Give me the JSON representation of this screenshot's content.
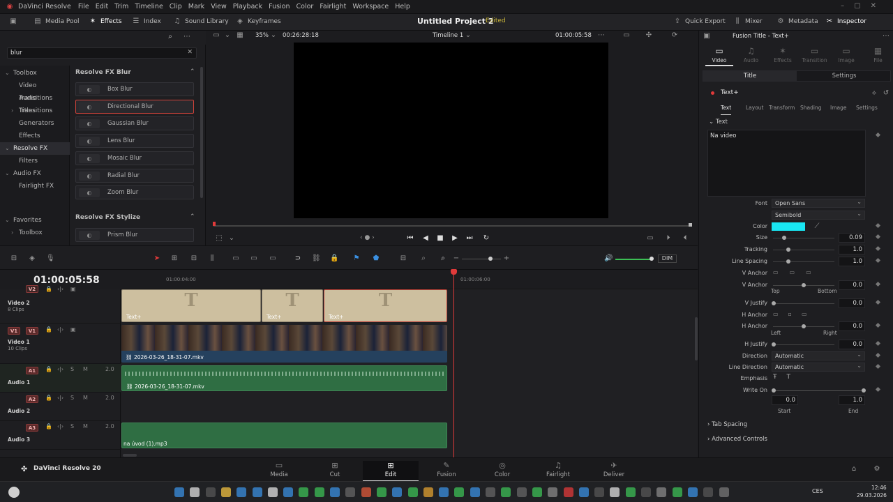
{
  "menu": {
    "app_name": "DaVinci Resolve",
    "items": [
      "File",
      "Edit",
      "Trim",
      "Timeline",
      "Clip",
      "Mark",
      "View",
      "Playback",
      "Fusion",
      "Color",
      "Fairlight",
      "Workspace",
      "Help"
    ]
  },
  "toolbar": {
    "media_pool": "Media Pool",
    "effects": "Effects",
    "index": "Index",
    "sound_library": "Sound Library",
    "keyframes": "Keyframes",
    "project_title": "Untitled Project 2",
    "project_status": "Edited",
    "quick_export": "Quick Export",
    "mixer": "Mixer",
    "metadata": "Metadata",
    "inspector": "Inspector"
  },
  "effects_panel": {
    "search_value": "blur",
    "tree": [
      {
        "label": "Toolbox",
        "level": 0,
        "caret": true
      },
      {
        "label": "Video Transitions",
        "level": 1
      },
      {
        "label": "Audio Transitions",
        "level": 1
      },
      {
        "label": "Titles",
        "level": 1,
        "caret": true
      },
      {
        "label": "Generators",
        "level": 1
      },
      {
        "label": "Effects",
        "level": 1
      },
      {
        "label": "Resolve FX",
        "level": 0,
        "caret": true,
        "selected": true
      },
      {
        "label": "Filters",
        "level": 1
      },
      {
        "label": "Audio FX",
        "level": 0,
        "caret": true
      },
      {
        "label": "Fairlight FX",
        "level": 1
      }
    ],
    "favorites": "Favorites",
    "favorites_toolbox": "Toolbox",
    "group1": "Resolve FX Blur",
    "items": [
      "Box Blur",
      "Directional Blur",
      "Gaussian Blur",
      "Lens Blur",
      "Mosaic Blur",
      "Radial Blur",
      "Zoom Blur"
    ],
    "selected_item": "Directional Blur",
    "group2": "Resolve FX Stylize",
    "group2_items": [
      "Prism Blur"
    ]
  },
  "viewer": {
    "zoom": "35%",
    "source_tc": "00:26:28:18",
    "timeline_name": "Timeline 1",
    "record_tc": "01:00:05:58"
  },
  "timeline": {
    "timecode": "01:00:05:58",
    "ruler_ticks": [
      "01:00:04:00",
      "01:00:06:00"
    ],
    "tracks": [
      {
        "id": "V2",
        "name": "Video 2",
        "sub": "8 Clips"
      },
      {
        "id": "V1",
        "name": "Video 1",
        "sub": "10 Clips"
      },
      {
        "id": "A1",
        "name": "Audio 1",
        "level": "2.0"
      },
      {
        "id": "A2",
        "name": "Audio 2",
        "level": "2.0"
      },
      {
        "id": "A3",
        "name": "Audio 3",
        "level": "2.0"
      }
    ],
    "title_clip_label": "Text+",
    "video_clip": "2026-03-26_18-31-07.mkv",
    "audio_clip": "2026-03-26_18-31-07.mkv",
    "audio3_clip": "na úvod (1).mp3",
    "dim": "DIM"
  },
  "inspector": {
    "header": "Fusion Title - Text+",
    "tabs": [
      "Video",
      "Audio",
      "Effects",
      "Transition",
      "Image",
      "File"
    ],
    "subtabs": [
      "Title",
      "Settings"
    ],
    "node": "Text+",
    "ptabs": [
      "Text",
      "Layout",
      "Transform",
      "Shading",
      "Image",
      "Settings"
    ],
    "section": "Text",
    "text_value": "Na video",
    "font_label": "Font",
    "font": "Open Sans",
    "style": "Semibold",
    "color_label": "Color",
    "color": "#19e6f2",
    "size_label": "Size",
    "size": "0.09",
    "tracking_label": "Tracking",
    "tracking": "1.0",
    "line_spacing_label": "Line Spacing",
    "line_spacing": "1.0",
    "v_anchor_label": "V Anchor",
    "v_anchor": "0.0",
    "top": "Top",
    "bottom": "Bottom",
    "v_justify_label": "V Justify",
    "v_justify": "0.0",
    "h_anchor_label": "H Anchor",
    "h_anchor": "0.0",
    "left": "Left",
    "right": "Right",
    "h_justify_label": "H Justify",
    "h_justify": "0.0",
    "direction_label": "Direction",
    "direction": "Automatic",
    "line_direction_label": "Line Direction",
    "line_direction": "Automatic",
    "emphasis_label": "Emphasis",
    "write_on_label": "Write On",
    "write_start": "0.0",
    "write_end": "1.0",
    "start": "Start",
    "end": "End",
    "tab_spacing": "Tab Spacing",
    "advanced": "Advanced Controls"
  },
  "pages": {
    "brand": "DaVinci Resolve 20",
    "items": [
      "Media",
      "Cut",
      "Edit",
      "Fusion",
      "Color",
      "Fairlight",
      "Deliver"
    ],
    "active": "Edit"
  },
  "taskbar": {
    "lang": "CES",
    "time": "12:46",
    "date": "29.03.2026"
  }
}
